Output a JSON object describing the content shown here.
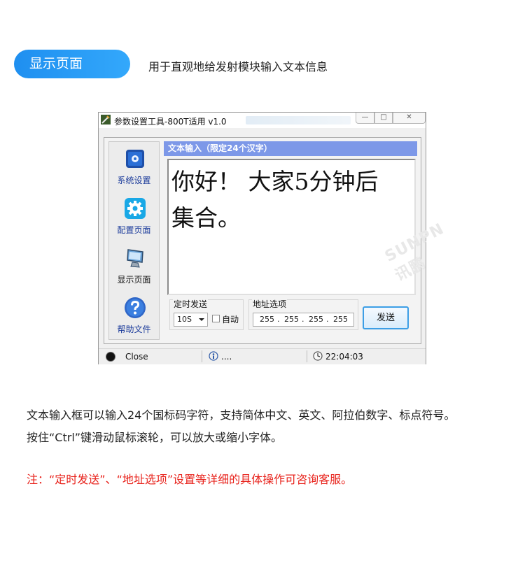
{
  "section": {
    "pill_label": "显示页面",
    "subtitle": "用于直观地给发射模块输入文本信息"
  },
  "window": {
    "title": "参数设置工具-800T适用 v1.0",
    "controls": {
      "minimize": "—",
      "maximize": "□",
      "close": "✕"
    }
  },
  "sidebar": {
    "items": [
      {
        "label": "系统设置",
        "icon": "system-settings-icon",
        "active": false
      },
      {
        "label": "配置页面",
        "icon": "config-gear-icon",
        "active": false
      },
      {
        "label": "显示页面",
        "icon": "monitor-display-icon",
        "active": true
      },
      {
        "label": "帮助文件",
        "icon": "help-question-icon",
        "active": false
      }
    ]
  },
  "main": {
    "header": "文本输入（限定24个汉字）",
    "text_value": "你好！ 大家5分钟后集合。",
    "text_line1": "你好！ 大家5分钟后",
    "text_line2": "集合。",
    "watermark": "SUNPN讯鹏"
  },
  "controls": {
    "timed_send_label": "定时发送",
    "interval_value": "10S",
    "auto_label": "自动",
    "auto_checked": false,
    "address_label": "地址选项",
    "ip": [
      "255",
      "255",
      "255",
      "255"
    ],
    "send_button": "发送"
  },
  "statusbar": {
    "close_label": "Close",
    "info": "....",
    "time": "22:04:03"
  },
  "description": {
    "line1": "文本输入框可以输入24个国标码字符，支持简体中文、英文、阿拉伯数字、标点符号。",
    "line2": "按住“Ctrl”键滑动鼠标滚轮，可以放大或缩小字体。",
    "note": "注：“定时发送”、“地址选项”设置等详细的具体操作可咨询客服。"
  },
  "colors": {
    "pill": "#1f8ff0",
    "header_bar": "#7d98e8",
    "note_red": "#e8231c",
    "send_border": "#3c9ee6"
  }
}
